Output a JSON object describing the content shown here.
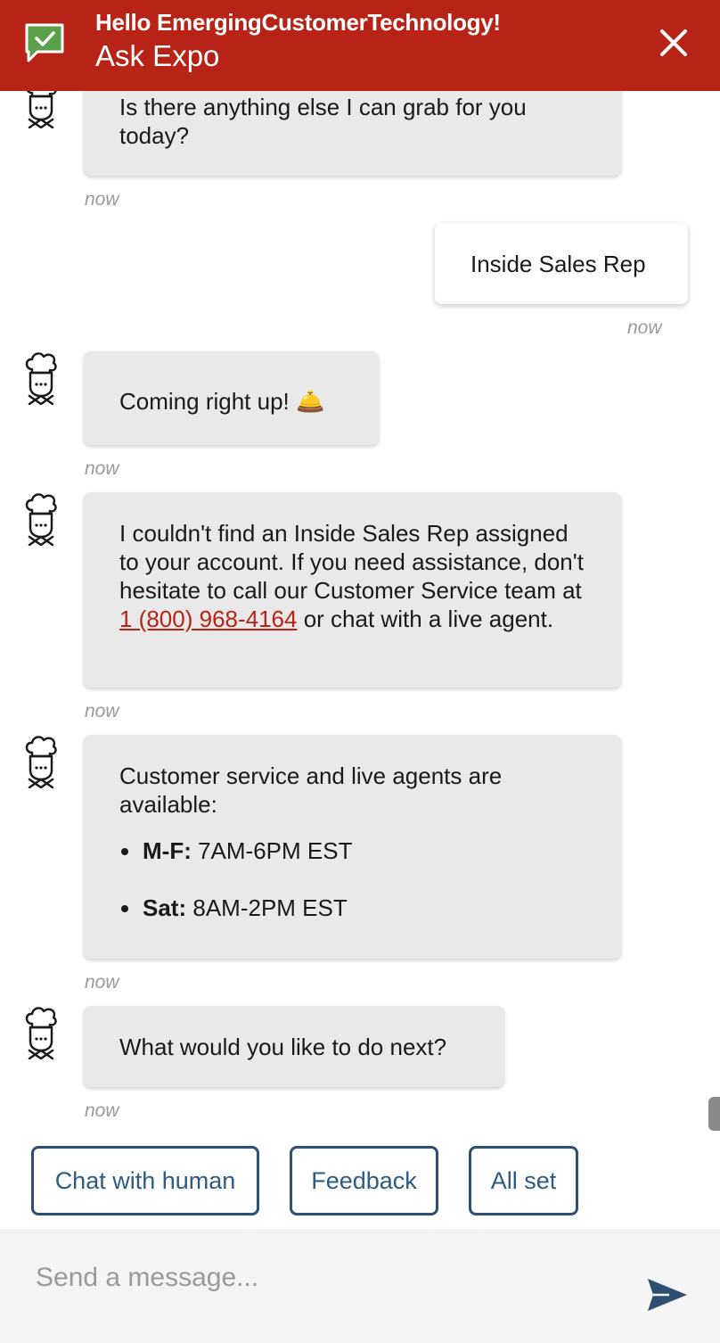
{
  "header": {
    "greeting": "Hello EmergingCustomerTechnology!",
    "title": "Ask Expo",
    "logo_icon": "chat-check-icon",
    "close_icon": "close-icon",
    "colors": {
      "background": "#b82318",
      "text": "#ffffff"
    }
  },
  "messages": [
    {
      "from": "bot",
      "text": "Is there anything else I can grab for you today?",
      "time": "now"
    },
    {
      "from": "user",
      "text": "Inside Sales Rep",
      "time": "now"
    },
    {
      "from": "bot",
      "text": "Coming right up! 🛎️",
      "time": "now"
    },
    {
      "from": "bot",
      "text_before": "I couldn't find an Inside Sales Rep assigned to your account. If you need assistance, don't hesitate to call our Customer Service team at ",
      "phone": "1 (800) 968-4164",
      "text_after": " or chat with a live agent.",
      "time": "now"
    },
    {
      "from": "bot",
      "text": "Customer service and live agents are available:",
      "hours": [
        {
          "day": "M-F:",
          "time": "7AM-6PM EST"
        },
        {
          "day": "Sat:",
          "time": "8AM-2PM EST"
        }
      ],
      "time": "now"
    },
    {
      "from": "bot",
      "text": "What would you like to do next?",
      "time": "now"
    }
  ],
  "avatar_icon": "chef-bot-icon",
  "quick_replies": [
    "Chat with human",
    "Feedback",
    "All set"
  ],
  "composer": {
    "placeholder": "Send a message...",
    "send_icon": "send-icon"
  },
  "colors": {
    "accent": "#b82318",
    "bot_bubble": "#e9e9e9",
    "quick_reply_border": "#2e4e72",
    "quick_reply_text": "#2e5a86",
    "timestamp": "#9a9a9a"
  }
}
